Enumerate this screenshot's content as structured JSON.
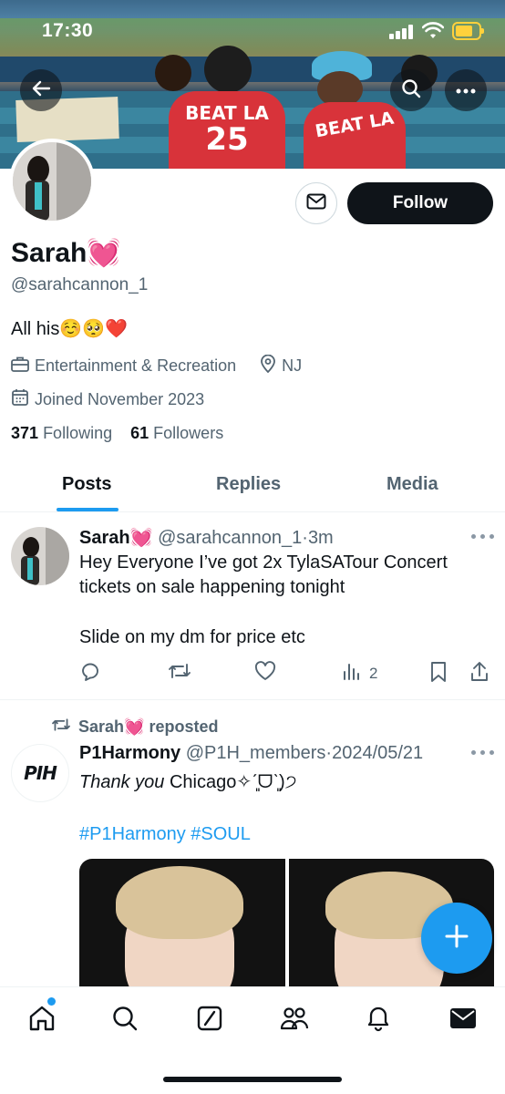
{
  "status_bar": {
    "time": "17:30"
  },
  "profile": {
    "display_name": "Sarah💓",
    "handle": "@sarahcannon_1",
    "bio": "All his☺️🥺❤️",
    "category": "Entertainment & Recreation",
    "location": "NJ",
    "joined": "Joined November 2023",
    "following_count": "371",
    "following_label": "Following",
    "followers_count": "61",
    "followers_label": "Followers",
    "follow_label": "Follow"
  },
  "tabs": [
    {
      "label": "Posts",
      "active": true
    },
    {
      "label": "Replies",
      "active": false
    },
    {
      "label": "Media",
      "active": false
    }
  ],
  "tweets": [
    {
      "name": "Sarah💓",
      "handle": "@sarahcannon_1",
      "separator": "·",
      "time": "3m",
      "text_line1": "Hey Everyone I’ve got 2x  TylaSATour Concert",
      "text_line2": "tickets on sale happening tonight",
      "text_line3": "Slide on my dm for price etc",
      "views": "2"
    },
    {
      "repost_label": "Sarah💓 reposted",
      "name": "P1Harmony",
      "handle": "@P1H_members",
      "separator": "·",
      "time": "2024/05/21",
      "text_italic": "Thank you",
      "text_rest": " Chicago✧ˊ͈ᗜˋ͈)੭",
      "hashtags": "#P1Harmony #SOUL",
      "avatar_logo": "PIH"
    }
  ],
  "banner_text": {
    "jersey_left_top": "BEAT LA",
    "jersey_left_number": "25",
    "jersey_right_top": "BEAT LA"
  },
  "colors": {
    "accent": "#1d9bf0",
    "text_primary": "#0f1419",
    "text_secondary": "#536471",
    "follow_button": "#0f1419",
    "dodgers_red": "#d8333a"
  },
  "icons": {
    "back": "back-arrow-icon",
    "search": "search-icon",
    "more": "more-icon",
    "message": "envelope-icon",
    "category": "briefcase-icon",
    "location": "location-pin-icon",
    "joined": "calendar-icon",
    "reply": "reply-icon",
    "retweet": "retweet-icon",
    "like": "heart-icon",
    "views": "views-chart-icon",
    "bookmark": "bookmark-icon",
    "share": "share-icon",
    "compose": "plus-icon"
  },
  "bottom_nav": [
    "home",
    "search",
    "grok",
    "communities",
    "notifications",
    "messages"
  ]
}
